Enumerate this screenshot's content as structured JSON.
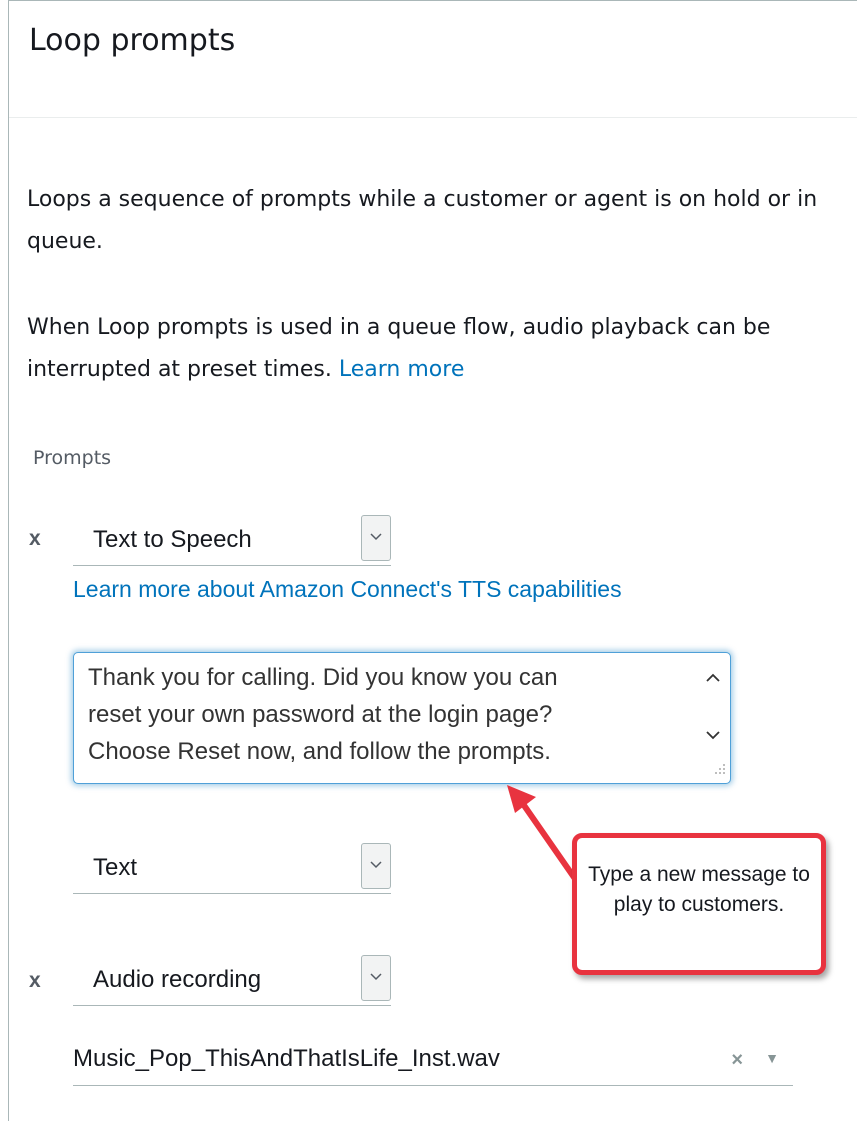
{
  "title": "Loop prompts",
  "description": "Loops a sequence of prompts while a customer or agent is on hold or in queue.",
  "queue_note": {
    "text": "When Loop prompts is used in a queue flow, audio playback can be interrupted at preset times.",
    "link": "Learn more"
  },
  "prompts": {
    "label": "Prompts",
    "remove_symbol": "x",
    "first": {
      "type": "Text to Speech",
      "tts_link": "Learn more about Amazon Connect's TTS capabilities",
      "message": "Thank you for calling. Did you know you can\nreset your own password at the login page?\nChoose Reset now, and follow the prompts.",
      "text_format": "Text"
    },
    "second": {
      "type": "Audio recording",
      "file": "Music_Pop_ThisAndThatIsLife_Inst.wav",
      "clear_symbol": "×",
      "caret_symbol": "▼"
    }
  },
  "callout": {
    "text": "Type a new message to play to customers.",
    "border_color": "#e8333f"
  },
  "colors": {
    "link": "#0073bb",
    "focus": "#4fa0d8"
  }
}
